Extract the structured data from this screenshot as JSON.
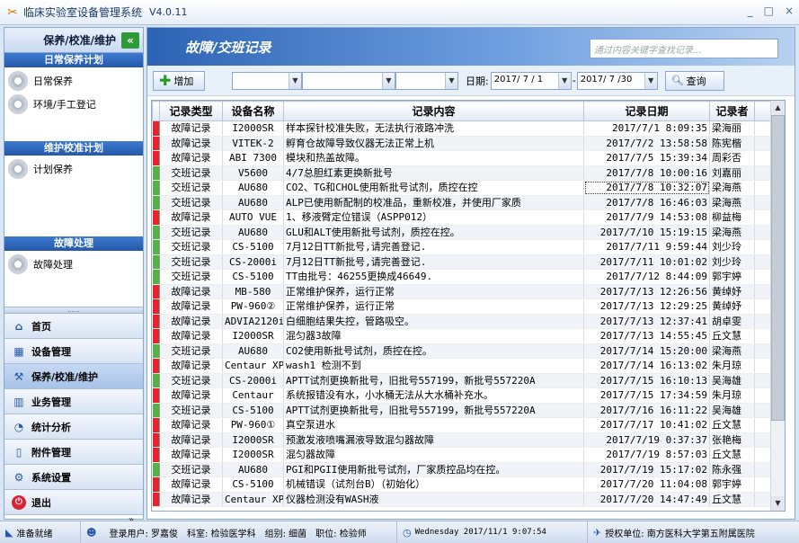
{
  "window": {
    "title": "临床实验室设备管理系统",
    "version": "V4.0.11",
    "controls": [
      "_",
      "□",
      "×"
    ]
  },
  "sidebar": {
    "header": "保养/校准/维护",
    "collapse_glyph": "«",
    "groups": [
      {
        "title": "日常保养计划",
        "items": [
          "日常保养",
          "环境/手工登记"
        ]
      },
      {
        "title": "维护校准计划",
        "items": [
          "计划保养"
        ]
      },
      {
        "title": "故障处理",
        "items": [
          "故障处理"
        ]
      }
    ],
    "splitter": "......",
    "nav": [
      {
        "label": "首页",
        "icon": "home-icon"
      },
      {
        "label": "设备管理",
        "icon": "device-icon"
      },
      {
        "label": "保养/校准/维护",
        "icon": "wrench-icon"
      },
      {
        "label": "业务管理",
        "icon": "chart-icon"
      },
      {
        "label": "统计分析",
        "icon": "stats-icon"
      },
      {
        "label": "附件管理",
        "icon": "attachment-icon"
      },
      {
        "label": "系统设置",
        "icon": "settings-icon"
      },
      {
        "label": "退出",
        "icon": "exit-icon"
      }
    ],
    "more_glyph": "»"
  },
  "main": {
    "title": "故障/交班记录",
    "search_placeholder": "通过内容关键字查找记录...",
    "toolbar": {
      "add_label": "增加",
      "date_label": "日期:",
      "date_from": "2017/ 7 / 1",
      "date_to": "2017/ 7 /30",
      "query_label": "查询"
    },
    "columns": [
      "记录类型",
      "设备名称",
      "记录内容",
      "记录日期",
      "记录者"
    ],
    "colors": {
      "fault": "#e8242b",
      "shift": "#55b244"
    },
    "rows": [
      {
        "type": "故障记录",
        "kind": "fault",
        "device": "I2000SR",
        "content": "样本探针校准失败，无法执行液路冲洗",
        "date": "2017/7/1  8:09:35",
        "by": "梁海丽"
      },
      {
        "type": "故障记录",
        "kind": "fault",
        "device": "VITEK-2",
        "content": "孵育仓故障导致仪器无法正常上机",
        "date": "2017/7/2 13:58:58",
        "by": "陈宪楷"
      },
      {
        "type": "故障记录",
        "kind": "fault",
        "device": "ABI 7300",
        "content": "模块和热盖故障。",
        "date": "2017/7/5 15:39:34",
        "by": "周彩否"
      },
      {
        "type": "交班记录",
        "kind": "shift",
        "device": "V5600",
        "content": "4/7总胆红素更换新批号",
        "date": "2017/7/8 10:00:16",
        "by": "刘嘉丽"
      },
      {
        "type": "交班记录",
        "kind": "shift",
        "device": "AU680",
        "content": "CO2、TG和CHOL使用新批号试剂，质控在控",
        "date": "2017/7/8 10:32:07",
        "by": "梁海燕"
      },
      {
        "type": "交班记录",
        "kind": "shift",
        "device": "AU680",
        "content": "ALP已使用新配制的校准品，重新校准，并使用厂家质",
        "date": "2017/7/8 16:46:03",
        "by": "梁海燕"
      },
      {
        "type": "故障记录",
        "kind": "fault",
        "device": "AUTO VUE",
        "content": "1、移液臂定位错误（ASPP012）",
        "date": "2017/7/9 14:53:08",
        "by": "柳益梅"
      },
      {
        "type": "交班记录",
        "kind": "shift",
        "device": "AU680",
        "content": "GLU和ALT使用新批号试剂，质控在控。",
        "date": "2017/7/10 15:19:15",
        "by": "梁海燕"
      },
      {
        "type": "交班记录",
        "kind": "shift",
        "device": "CS-5100",
        "content": "7月12日TT新批号,请完善登记.",
        "date": "2017/7/11  9:59:44",
        "by": "刘少玲"
      },
      {
        "type": "交班记录",
        "kind": "shift",
        "device": "CS-2000i",
        "content": "7月12日TT新批号,请完善登记.",
        "date": "2017/7/11 10:01:02",
        "by": "刘少玲"
      },
      {
        "type": "交班记录",
        "kind": "shift",
        "device": "CS-5100",
        "content": "TT由批号：46255更换成46649.",
        "date": "2017/7/12  8:44:09",
        "by": "郭宇婷"
      },
      {
        "type": "故障记录",
        "kind": "fault",
        "device": "MB-580",
        "content": "正常维护保养，运行正常",
        "date": "2017/7/13 12:26:56",
        "by": "黄绰妤"
      },
      {
        "type": "故障记录",
        "kind": "fault",
        "device": "PW-960②",
        "content": "正常维护保养，运行正常",
        "date": "2017/7/13 12:29:25",
        "by": "黄绰妤"
      },
      {
        "type": "故障记录",
        "kind": "fault",
        "device": "ADVIA2120i",
        "content": "白细胞结果失控，管路吸空。",
        "date": "2017/7/13 12:37:41",
        "by": "胡卓雯"
      },
      {
        "type": "故障记录",
        "kind": "fault",
        "device": "I2000SR",
        "content": "混匀器3故障",
        "date": "2017/7/13 14:55:45",
        "by": "丘文慧"
      },
      {
        "type": "交班记录",
        "kind": "shift",
        "device": "AU680",
        "content": "CO2使用新批号试剂，质控在控。",
        "date": "2017/7/14 15:20:00",
        "by": "梁海燕"
      },
      {
        "type": "故障记录",
        "kind": "fault",
        "device": "Centaur XP",
        "content": "wash1 检测不到",
        "date": "2017/7/14 16:13:02",
        "by": "朱月琼"
      },
      {
        "type": "交班记录",
        "kind": "shift",
        "device": "CS-2000i",
        "content": "APTT试剂更换新批号，旧批号557199，新批号557220A",
        "date": "2017/7/15 16:10:13",
        "by": "吴海雄"
      },
      {
        "type": "故障记录",
        "kind": "fault",
        "device": "Centaur",
        "content": "系统报错没有水，小水桶无法从大水桶补充水。",
        "date": "2017/7/15 17:34:59",
        "by": "朱月琼"
      },
      {
        "type": "交班记录",
        "kind": "shift",
        "device": "CS-5100",
        "content": "APTT试剂更换新批号，旧批号557199，新批号557220A",
        "date": "2017/7/16 16:11:22",
        "by": "吴海雄"
      },
      {
        "type": "故障记录",
        "kind": "fault",
        "device": "PW-960①",
        "content": "真空泵进水",
        "date": "2017/7/17 10:41:02",
        "by": "丘文慧"
      },
      {
        "type": "故障记录",
        "kind": "fault",
        "device": "I2000SR",
        "content": "预激发液喷嘴漏液导致混匀器故障",
        "date": "2017/7/19  0:37:37",
        "by": "张艳梅"
      },
      {
        "type": "故障记录",
        "kind": "fault",
        "device": "I2000SR",
        "content": "混匀器故障",
        "date": "2017/7/19  8:57:03",
        "by": "丘文慧"
      },
      {
        "type": "交班记录",
        "kind": "shift",
        "device": "AU680",
        "content": "PGI和PGII使用新批号试剂，厂家质控品均在控。",
        "date": "2017/7/19 15:17:02",
        "by": "陈永强"
      },
      {
        "type": "故障记录",
        "kind": "fault",
        "device": "CS-5100",
        "content": "机械错误（试剂台B）（初始化）",
        "date": "2017/7/20 11:04:08",
        "by": "郭宇婷"
      },
      {
        "type": "故障记录",
        "kind": "fault",
        "device": "Centaur XP",
        "content": "仪器检测没有WASH液",
        "date": "2017/7/20 14:47:49",
        "by": "丘文慧"
      }
    ]
  },
  "statusbar": {
    "status": "准备就绪",
    "user": "登录用户: 罗嘉俊",
    "dept": "科室: 检验医学科",
    "group": "组别: 细菌",
    "role": "职位: 检验师",
    "datetime": "Wednesday 2017/11/1  9:07:54",
    "org": "授权单位: 南方医科大学第五附属医院"
  }
}
